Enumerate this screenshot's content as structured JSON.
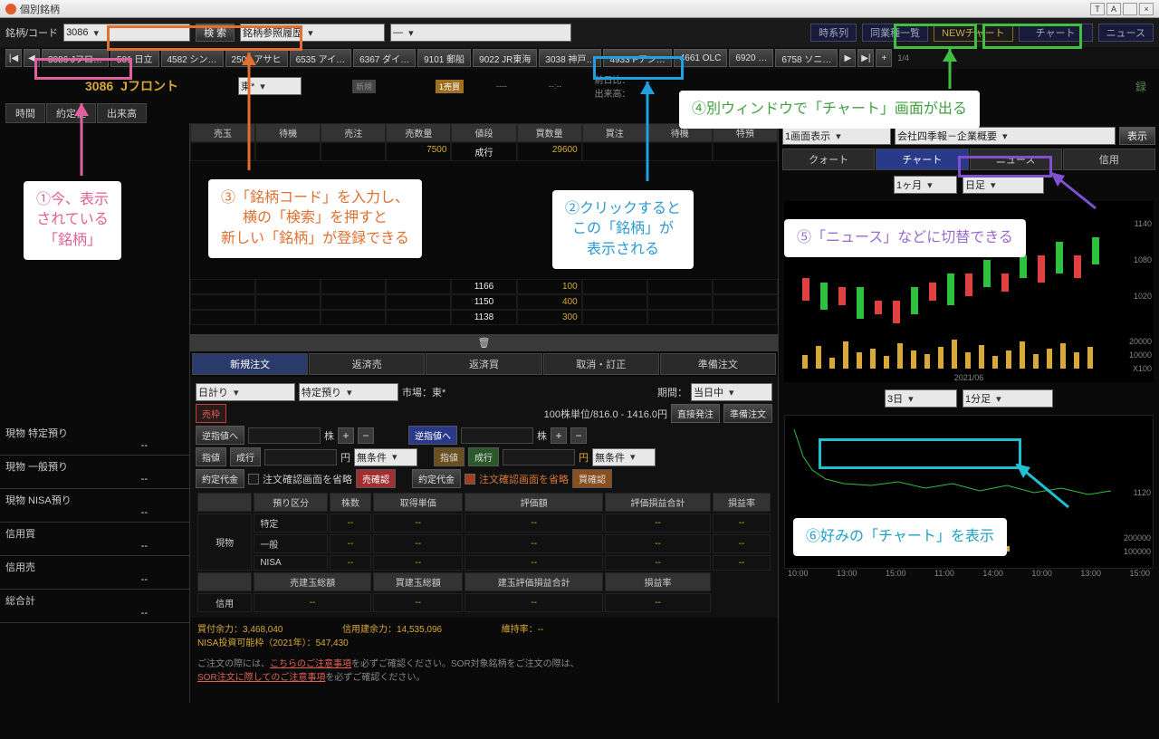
{
  "window": {
    "title": "個別銘柄"
  },
  "toolbar": {
    "code_label": "銘柄/コード",
    "code_value": "3086",
    "search": "検 索",
    "history_label": "銘柄参照履歴",
    "dash": "―",
    "jikei": "時系列",
    "dougyou": "同業種一覧",
    "newchart": "NEWチャート",
    "chart": "チャート",
    "news": "ニュース"
  },
  "history": [
    "3086 Jフロ…",
    "501 日立",
    "4582 シン…",
    "2502 アサヒ",
    "6535 アイ…",
    "6367 ダイ…",
    "9101 郵船",
    "9022 JR東海",
    "3038 神戸…",
    "4933 Pアン…",
    "4661 OLC",
    "6920 …",
    "6758 ソニ…"
  ],
  "pager": "1/4",
  "stock": {
    "code": "3086",
    "name": "Jフロント",
    "market": "東*",
    "prevday_label": "前日比：",
    "volume_label": "出来高：",
    "time": "--:--",
    "val": "----"
  },
  "left_tabs": [
    "時間",
    "約定値",
    "出来高"
  ],
  "accounts": [
    {
      "l": "現物 特定預り",
      "v": "--"
    },
    {
      "l": "現物 一般預り",
      "v": "--"
    },
    {
      "l": "現物 NISA預り",
      "v": "--"
    },
    {
      "l": "信用買",
      "v": "--"
    },
    {
      "l": "信用売",
      "v": "--"
    },
    {
      "l": "総合計",
      "v": "--"
    }
  ],
  "board": {
    "headers": [
      "売玉",
      "待機",
      "売注",
      "売数量",
      "値段",
      "買数量",
      "買注",
      "待機",
      "特預"
    ],
    "toprow": {
      "sell_qty": "7500",
      "price": "成行",
      "buy_qty": "29600"
    },
    "rows": [
      {
        "price": "1166",
        "buy": "100"
      },
      {
        "price": "1150",
        "buy": "400"
      },
      {
        "price": "1138",
        "buy": "300"
      }
    ]
  },
  "order_tabs": [
    "新規注文",
    "返済売",
    "返済買",
    "取消・訂正",
    "準備注文"
  ],
  "order": {
    "hibakari": "日計り",
    "tokutei": "特定預り",
    "market_lbl": "市場：東*",
    "period_lbl": "期間：",
    "period_val": "当日中",
    "uriwaku": "売枠",
    "unit": "100株単位/816.0 - 1416.0円",
    "chokusetsu": "直接発注",
    "junbi": "準備注文",
    "gyaku": "逆指値へ",
    "kabu": "株",
    "en": "円",
    "sashine": "指値",
    "nariyuki": "成行",
    "mujouken": "無条件",
    "yakudai": "約定代金",
    "shouryaku": "注文確認画面を省略",
    "urikakunin": "売確認",
    "kaikakunin": "買確認"
  },
  "pos_headers": [
    "預り区分",
    "株数",
    "取得単価",
    "評価額",
    "評価損益合計",
    "損益率"
  ],
  "pos_side": {
    "genbutsu": "現物",
    "shinyou": "信用"
  },
  "pos_rows": [
    "特定",
    "一般",
    "NISA"
  ],
  "pos_headers2": [
    "売建玉総額",
    "買建玉総額",
    "建玉評価損益合計",
    "損益率"
  ],
  "summary": {
    "l1a": "買付余力：",
    "l1av": "3,468,040",
    "l1b": "信用建余力：",
    "l1bv": "14,535,096",
    "l1c": "維持率：",
    "l1cv": "--",
    "l2a": "NISA投資可能枠（2021年）：",
    "l2av": "547,430"
  },
  "footnote": {
    "t1": "ご注文の際には、",
    "link1": "こちらのご注意事項",
    "t2": "を必ずご確認ください。SOR対象銘柄をご注文の際は、",
    "link2": "SOR注文に際してのご注意事項",
    "t3": "を必ずご確認ください。"
  },
  "right": {
    "disp": "1画面表示",
    "shikihou": "会社四季報－企業概要",
    "hyouji": "表示",
    "tabs": [
      "クォート",
      "チャート",
      "ニュース",
      "信用"
    ],
    "period1": "1ヶ月",
    "ashi1": "日足",
    "period2": "3日",
    "ashi2": "1分足",
    "xlabel": "2021/06",
    "y1": [
      "1140",
      "1080",
      "1020"
    ],
    "y1v": [
      "20000",
      "10000",
      "X100"
    ],
    "y2": [
      "1120"
    ],
    "y2v": [
      "200000",
      "100000"
    ],
    "x2": [
      "10:00",
      "13:00",
      "15:00",
      "11:00",
      "14:00",
      "10:00",
      "13:00",
      "15:00"
    ]
  },
  "annotations": {
    "a1": "①今、表示\nされている\n「銘柄」",
    "a2": "②クリックすると\nこの「銘柄」が\n表示される",
    "a3": "③「銘柄コード」を入力し、\n横の「検索」を押すと\n新しい「銘柄」が登録できる",
    "a4": "④別ウィンドウで「チャート」画面が出る",
    "a5": "⑤「ニュース」などに切替できる",
    "a6": "⑥好みの「チャート」を表示"
  },
  "chart_data": {
    "type": "candlestick",
    "upper": {
      "ylim": [
        1000,
        1160
      ],
      "period": "2021/06"
    },
    "lower": {
      "ylim": [
        1100,
        1140
      ],
      "xticks": [
        "10:00",
        "13:00",
        "15:00",
        "11:00",
        "14:00",
        "10:00",
        "13:00",
        "15:00"
      ]
    }
  }
}
